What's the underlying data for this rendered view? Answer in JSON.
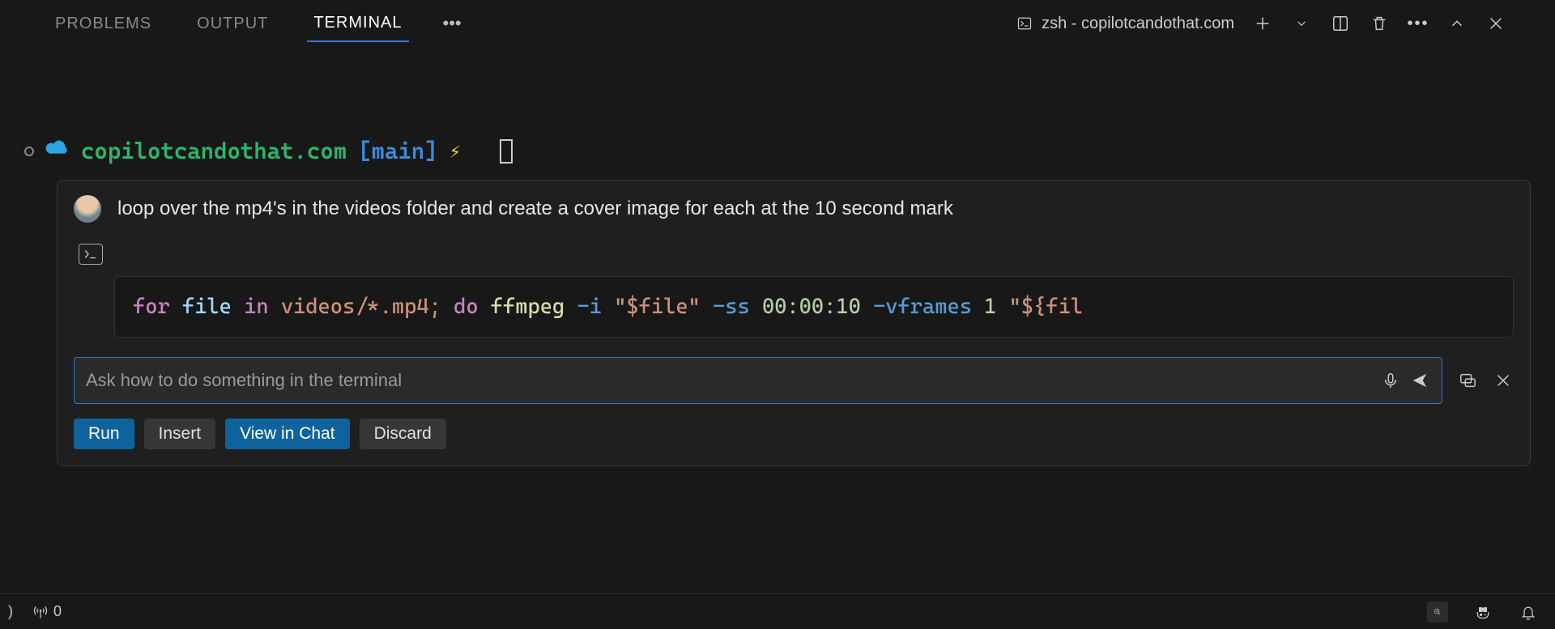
{
  "panel": {
    "tabs": {
      "problems": "PROBLEMS",
      "output": "OUTPUT",
      "terminal": "TERMINAL"
    },
    "active_tab": "terminal",
    "terminal_label": "zsh - copilotcandothat.com"
  },
  "prompt": {
    "cwd": "copilotcandothat.com",
    "branch": "[main]"
  },
  "copilot": {
    "user_message": "loop over the mp4's in the videos folder and create a cover image for each at the 10 second mark",
    "code": {
      "kw_for": "for",
      "var_file": "file",
      "kw_in": "in",
      "glob": "videos/*.mp4;",
      "kw_do": "do",
      "cmd": "ffmpeg",
      "flag_i": "-i",
      "str_file": "\"$file\"",
      "flag_ss": "-ss",
      "time": "00:00:10",
      "flag_vframes": "-vframes",
      "num_one": "1",
      "str_out": "\"${fil"
    },
    "input_placeholder": "Ask how to do something in the terminal",
    "buttons": {
      "run": "Run",
      "insert": "Insert",
      "view_in_chat": "View in Chat",
      "discard": "Discard"
    }
  },
  "statusbar": {
    "ports_count": "0",
    "left_glyph": ")"
  }
}
